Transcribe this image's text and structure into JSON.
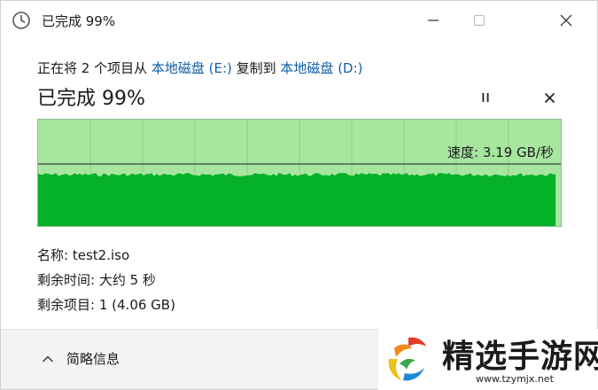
{
  "window": {
    "title": "已完成 99%",
    "icon": "clock-icon"
  },
  "transfer": {
    "prefix": "正在将 2 个项目从 ",
    "source": "本地磁盘 (E:)",
    "middle": " 复制到 ",
    "destination": "本地磁盘 (D:)",
    "status": "已完成 99%",
    "progress_percent": 99,
    "speed_label": "速度: 3.19 GB/秒"
  },
  "details": {
    "name_label": "名称:",
    "name_value": "test2.iso",
    "time_label": "剩余时间:",
    "time_value": "大约 5 秒",
    "items_label": "剩余项目:",
    "items_value": "1 (4.06 GB)"
  },
  "footer": {
    "collapse_label": "简略信息"
  },
  "watermark": {
    "brand": "精选手游网",
    "url": "www.tzymjx.net"
  },
  "colors": {
    "graph_bg": "#a8e6a0",
    "graph_fill": "#06b12a",
    "graph_grid": "#8fcf86",
    "link": "#0f5fa8"
  }
}
